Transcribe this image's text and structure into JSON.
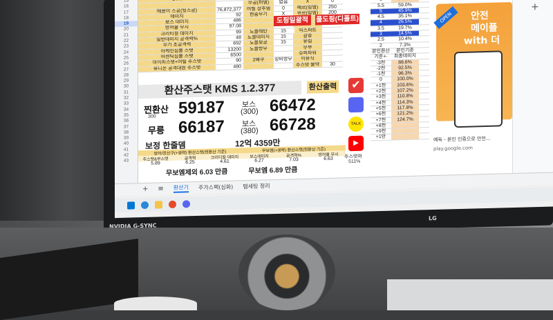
{
  "sheet": {
    "row_numbers": [
      "15",
      "16",
      "17",
      "18",
      "19",
      "20",
      "21",
      "22",
      "23",
      "24",
      "25",
      "26",
      "27",
      "28",
      "29",
      "30",
      "31",
      "32",
      "33",
      "34",
      "35",
      "36",
      "37",
      "38",
      "39",
      "40",
      "41",
      "42",
      "43"
    ],
    "selected_row": "19",
    "stat_rows": [
      {
        "label": "STR",
        "value": "7830",
        "label2": "공격력 %",
        "value2": "42",
        "label3": "계열 공격",
        "value3": "2"
      },
      {
        "label": "",
        "value": "",
        "label2": "무공(퍼뎀)",
        "value2": "없음",
        "label3": "X",
        "value3": "0"
      },
      {
        "label": "메용이 스공(뒷스공)",
        "value": "76,872,377",
        "label2": "어빌 상추뎀",
        "value2": "0",
        "label3": "메르(링뎀)",
        "value3": "250"
      },
      {
        "label": "데미지",
        "value": "92",
        "label2": "한숨무기",
        "value2": "X",
        "label3": "위르(링뎀)",
        "value3": "200"
      },
      {
        "label": "보스 데미지",
        "value": "486",
        "label2": "",
        "value2": "",
        "label3": "",
        "value3": ""
      },
      {
        "label": "방어율 무시",
        "value": "97.08",
        "label2": "",
        "value2": "",
        "label3": "",
        "value3": ""
      },
      {
        "label": "크리티컬 데미지",
        "value": "99",
        "label2": "노블레탄",
        "value2": "15",
        "label3": "익스퍼트",
        "value3": ""
      },
      {
        "label": "일반데미지 공격력%",
        "value": "48",
        "label2": "노블데미지",
        "value2": "15",
        "label3": "갈중",
        "value3": ""
      },
      {
        "label": "무기 초공격력",
        "value": "692",
        "label2": "노블보공",
        "value2": "15",
        "label3": "유림",
        "value3": ""
      },
      {
        "label": "아케인심볼 스탯",
        "value": "13200",
        "label2": "노블방무",
        "value2": "",
        "label3": "무부",
        "value3": ""
      },
      {
        "label": "어센틱심볼 스탯",
        "value": "6500",
        "label2": "",
        "value2": "",
        "label3": "슈퍼파워",
        "value3": ""
      },
      {
        "label": "마이피스탯+어빌 주스탯",
        "value": "90",
        "label2": "2배쿠",
        "value2": "장비방무",
        "label3": "이유식",
        "value3": ""
      },
      {
        "label": "유니온 공격대원 주스탯",
        "value": "480",
        "label2": "",
        "value2": "",
        "label3": "주스탯 물약",
        "value3": "30"
      }
    ],
    "buttons": {
      "apply_doping": "도핑일괄적용",
      "full_doping": "풀도핑(디폴트)"
    },
    "percent_table": [
      {
        "a": "6.5",
        "b": "94.5%"
      },
      {
        "a": "6",
        "b": "74.9%"
      },
      {
        "a": "5.5",
        "b": "59.0%"
      },
      {
        "a": "5",
        "b": "45.9%"
      },
      {
        "a": "4.5",
        "b": "35.1%"
      },
      {
        "a": "4",
        "b": "26.5%"
      },
      {
        "a": "3.5",
        "b": "19.7%"
      },
      {
        "a": "3",
        "b": "14.5%"
      },
      {
        "a": "2.5",
        "b": "10.4%"
      },
      {
        "a": "2",
        "b": "7.3%"
      },
      {
        "a": "본인환산",
        "b": "본인기준"
      },
      {
        "a": "기준+-",
        "b": "최종데미지"
      },
      {
        "a": "-3천",
        "b": "88.6%"
      },
      {
        "a": "-2천",
        "b": "92.5%"
      },
      {
        "a": "-1천",
        "b": "96.3%"
      },
      {
        "a": "0",
        "b": "100.0%"
      },
      {
        "a": "+1천",
        "b": "103.6%"
      },
      {
        "a": "+2천",
        "b": "107.2%"
      },
      {
        "a": "+3천",
        "b": "110.8%"
      },
      {
        "a": "+4천",
        "b": "114.3%"
      },
      {
        "a": "+5천",
        "b": "117.8%"
      },
      {
        "a": "+6천",
        "b": "121.2%"
      },
      {
        "a": "+7천",
        "b": "124.7%"
      },
      {
        "a": "+8천",
        "b": ""
      },
      {
        "a": "+9천",
        "b": ""
      },
      {
        "a": "+1만",
        "b": ""
      }
    ]
  },
  "calc": {
    "title": "환산주스탯 KMS 1.2.377",
    "output_button": "환산출력",
    "real_label": "찐환산",
    "real_value": "59187",
    "real_sub": "300",
    "boss_label": "보스",
    "boss1_sub": "(300)",
    "boss1_value": "66472",
    "murung_label": "무릉",
    "murung_value": "66187",
    "boss2_sub": "(380)",
    "boss2_value": "66728",
    "correction_label": "보정 한줄뎀",
    "correction_value": "12억 4359만",
    "header1": "방어/정산구(+생략) 환산스탯(찐환산 기준)",
    "header2": "무보엠(+생략) 환산스탯(찐환산 기준)",
    "cols": [
      "주스탯&부스탯",
      "공격력",
      "크리티컬 데미지",
      "보스데미지",
      "공격력%",
      "방어율 무시"
    ],
    "vals": [
      "5.89",
      "6.25",
      "4.61",
      "6.27",
      "7.03",
      "6.63"
    ],
    "stat_effect_label": "주스탯퍼",
    "stat_effect_value": "511%",
    "no_emblem_excl": "무보엠제외 6.03 만큼",
    "no_emblem": "무보엠 6.89 만큼"
  },
  "tabs": [
    "환산기",
    "주가스펙(심화)",
    "템세팅 정리"
  ],
  "ad": {
    "open": "OPEN",
    "line1": "안전",
    "line2": "메이플",
    "line3": "with 더",
    "caption": "예독 - 본인 인증으로 안전...",
    "source": "play.google.com"
  },
  "monitor": {
    "brand_left": "NVIDIA  G-SYNC",
    "brand_right": "LG"
  },
  "icons": [
    "checkbox-icon",
    "discord-icon",
    "kakaotalk-icon",
    "youtube-icon"
  ]
}
